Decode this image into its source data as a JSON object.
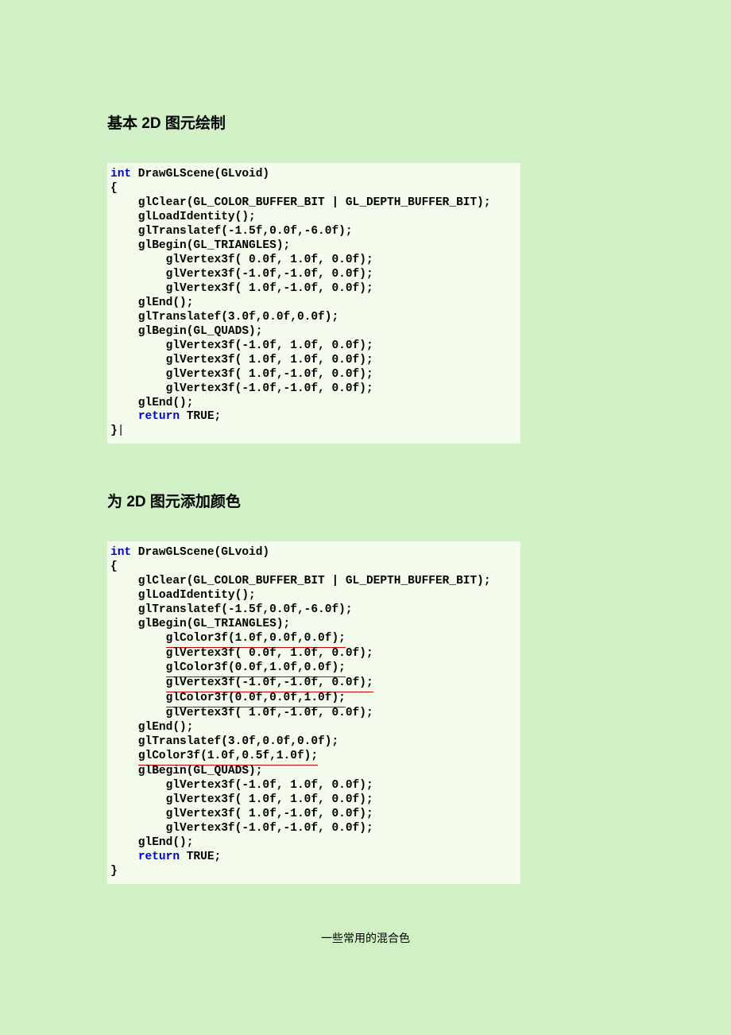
{
  "sections": {
    "s1": {
      "heading": "基本 2D 图元绘制",
      "code": {
        "kw_int": "int",
        "line1": " DrawGLScene(GLvoid)",
        "line2": "{",
        "line3": "    glClear(GL_COLOR_BUFFER_BIT | GL_DEPTH_BUFFER_BIT);",
        "line4": "    glLoadIdentity();",
        "line5": "    glTranslatef(-1.5f,0.0f,-6.0f);",
        "line6": "    glBegin(GL_TRIANGLES);",
        "line7": "        glVertex3f( 0.0f, 1.0f, 0.0f);",
        "line8": "        glVertex3f(-1.0f,-1.0f, 0.0f);",
        "line9": "        glVertex3f( 1.0f,-1.0f, 0.0f);",
        "line10": "    glEnd();",
        "line11": "    glTranslatef(3.0f,0.0f,0.0f);",
        "line12": "    glBegin(GL_QUADS);",
        "line13": "        glVertex3f(-1.0f, 1.0f, 0.0f);",
        "line14": "        glVertex3f( 1.0f, 1.0f, 0.0f);",
        "line15": "        glVertex3f( 1.0f,-1.0f, 0.0f);",
        "line16": "        glVertex3f(-1.0f,-1.0f, 0.0f);",
        "line17": "    glEnd();",
        "indent_ret": "    ",
        "kw_return": "return",
        "ret_tail": " TRUE;",
        "line19": "}"
      }
    },
    "s2": {
      "heading": "为 2D 图元添加颜色",
      "code": {
        "kw_int": "int",
        "line1": " DrawGLScene(GLvoid)",
        "line2": "{",
        "line3": "    glClear(GL_COLOR_BUFFER_BIT | GL_DEPTH_BUFFER_BIT);",
        "line4": "    glLoadIdentity();",
        "line5": "    glTranslatef(-1.5f,0.0f,-6.0f);",
        "line6": "    glBegin(GL_TRIANGLES);",
        "indent8": "        ",
        "u1": "glColor3f(1.0f,0.0f,0.0f);",
        "line8": "        glVertex3f( 0.0f, 1.0f, 0.0f);",
        "u2": "glColor3f(0.0f,1.0f,0.0f);",
        "u3": "glVertex3f(-1.0f,-1.0f, 0.0f);",
        "u4": "glColor3f(0.0f,0.0f,1.0f);",
        "line12_plain": "        glVertex3f( 1.0f,-1.0f, 0.0f);",
        "line13": "    glEnd();",
        "line14": "    glTranslatef(3.0f,0.0f,0.0f);",
        "indent4": "    ",
        "u5": "glColor3f(1.0f,0.5f,1.0f);",
        "line16": "    glBegin(GL_QUADS);",
        "line17": "        glVertex3f(-1.0f, 1.0f, 0.0f);",
        "line18": "        glVertex3f( 1.0f, 1.0f, 0.0f);",
        "line19": "        glVertex3f( 1.0f,-1.0f, 0.0f);",
        "line20": "        glVertex3f(-1.0f,-1.0f, 0.0f);",
        "line21": "    glEnd();",
        "kw_return": "return",
        "ret_tail": " TRUE;",
        "line23": "}"
      }
    },
    "caption": "一些常用的混合色"
  }
}
